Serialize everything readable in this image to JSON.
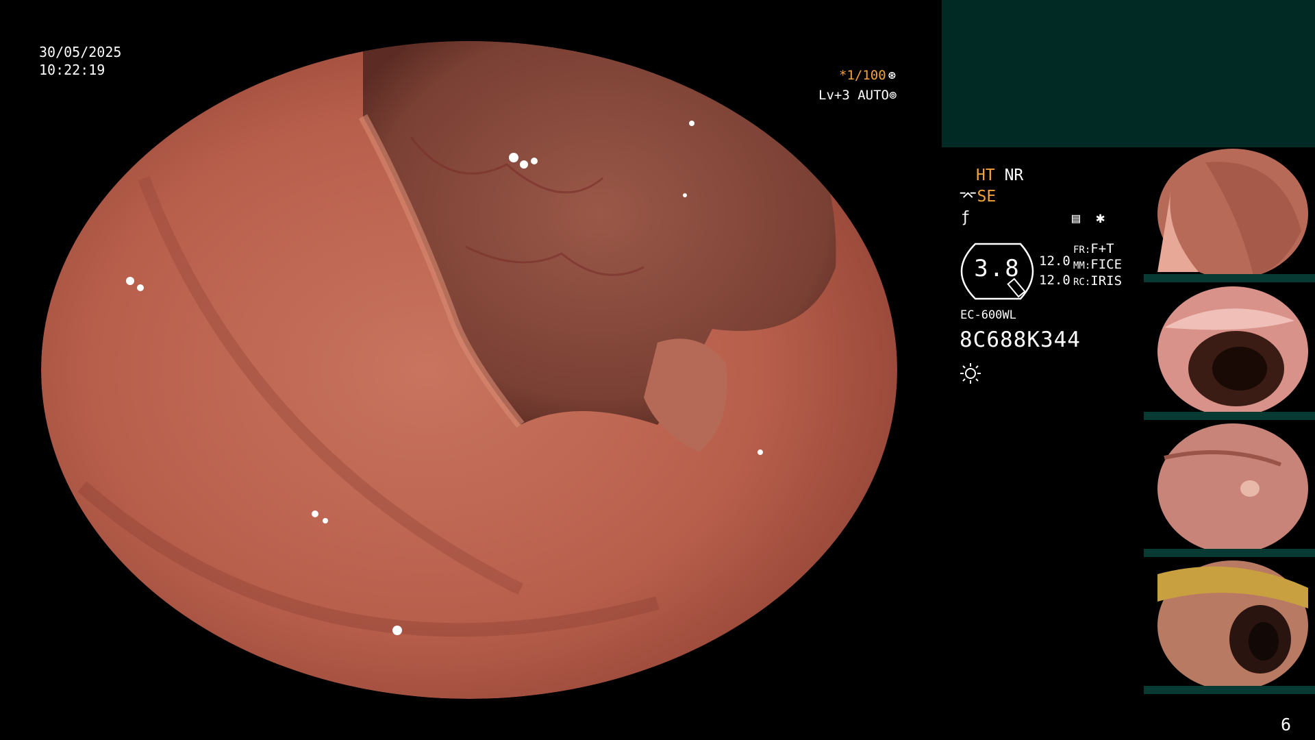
{
  "overlay": {
    "date": "30/05/2025",
    "time": "10:22:19",
    "shutter": "*1/100",
    "level": "Lv+3 AUTO"
  },
  "settings": {
    "ht": "HT",
    "nr": "NR",
    "se": "SE",
    "gauge_value": "3.8",
    "param1": "12.0",
    "param2": "12.0",
    "fr_key": "FR:",
    "fr_val": "F+T",
    "mm_key": "MM:",
    "mm_val": "FICE",
    "rc_key": "RC:",
    "rc_val": "IRIS",
    "scope_model": "EC-600WL",
    "scope_serial": "8C688K344"
  },
  "page_number": "6",
  "colors": {
    "accent_orange": "#f2a33a",
    "panel_teal": "#012a25"
  },
  "icons": [
    "shutter-icon",
    "auto-icon",
    "hood-icon",
    "f-icon",
    "memo-icon",
    "star-icon",
    "light-icon"
  ]
}
